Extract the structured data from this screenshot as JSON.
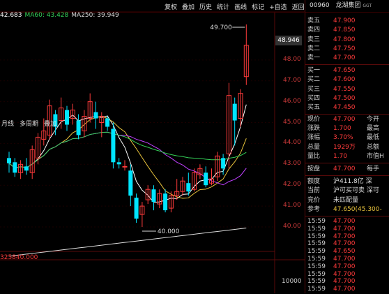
{
  "toolbar": [
    "复权",
    "叠加",
    "历史",
    "统计",
    "画线",
    "标记",
    "+自选",
    "返回"
  ],
  "ma_legend": [
    {
      "text": "42.683",
      "color": "#ffffff"
    },
    {
      "text": "MA60: 43.428",
      "color": "#34d058"
    },
    {
      "text": "MA250: 39.949",
      "color": "#dddddd"
    }
  ],
  "chart_tabs": [
    "月线",
    "多周期",
    "叠加"
  ],
  "stock": {
    "code": "00960",
    "name": "龙湖集团",
    "tag": "GGT"
  },
  "price_axis": [
    {
      "v": "48.946",
      "boxed": true
    },
    {
      "v": "48.00"
    },
    {
      "v": "47.00"
    },
    {
      "v": "46.00"
    },
    {
      "v": "45.00"
    },
    {
      "v": "44.00"
    },
    {
      "v": "43.00"
    },
    {
      "v": "42.00"
    },
    {
      "v": "41.00"
    },
    {
      "v": "40.00"
    }
  ],
  "high_label": "49.700",
  "low_label": "40.000",
  "volume_label": "325840.000",
  "volume_axis": "10000",
  "asks": [
    {
      "l": "卖五",
      "p": "47.900"
    },
    {
      "l": "卖四",
      "p": "47.850"
    },
    {
      "l": "卖三",
      "p": "47.800"
    },
    {
      "l": "卖二",
      "p": "47.750"
    },
    {
      "l": "卖一",
      "p": "47.700"
    }
  ],
  "bids": [
    {
      "l": "买一",
      "p": "47.650"
    },
    {
      "l": "买二",
      "p": "47.600"
    },
    {
      "l": "买三",
      "p": "47.550"
    },
    {
      "l": "买四",
      "p": "47.500"
    },
    {
      "l": "买五",
      "p": "47.450"
    }
  ],
  "stats": [
    {
      "l": "现价",
      "v": "47.700",
      "l2": "今开"
    },
    {
      "l": "涨跌",
      "v": "1.700",
      "l2": "最高"
    },
    {
      "l": "涨幅",
      "v": "3.70%",
      "l2": "最低"
    },
    {
      "l": "总量",
      "v": "1929万",
      "l2": "总额"
    },
    {
      "l": "量比",
      "v": "1.70",
      "l2": "市值H"
    }
  ],
  "pan": {
    "l": "按盘",
    "v": "47.700",
    "l2": "每手"
  },
  "extra": [
    {
      "l": "额度",
      "v": "沪411.8亿 深"
    },
    {
      "l": "当前",
      "v": "沪可买可卖 深可"
    },
    {
      "l": "竞价",
      "v": "未匹配量"
    },
    {
      "l": "参考",
      "v": "47.650(45.300-"
    }
  ],
  "ticks": [
    {
      "t": "15:59",
      "p": "47.700",
      "c": "red"
    },
    {
      "t": "15:59",
      "p": "47.700",
      "c": "red"
    },
    {
      "t": "15:59",
      "p": "47.700",
      "c": "red"
    },
    {
      "t": "15:59",
      "p": "47.700",
      "c": "red"
    },
    {
      "t": "15:59",
      "p": "47.650",
      "c": "red"
    },
    {
      "t": "15:59",
      "p": "47.700",
      "c": "red"
    },
    {
      "t": "15:59",
      "p": "47.700",
      "c": "red"
    },
    {
      "t": "15:59",
      "p": "47.700",
      "c": "red"
    },
    {
      "t": "15:59",
      "p": "47.700",
      "c": "red"
    },
    {
      "t": "15:59",
      "p": "47.700",
      "c": "red"
    }
  ],
  "candles": [
    [
      43.3,
      43.05,
      43.6,
      42.6
    ],
    [
      43.1,
      42.6,
      43.3,
      42.4
    ],
    [
      42.6,
      43.0,
      43.2,
      42.3
    ],
    [
      42.9,
      42.7,
      43.3,
      42.5
    ],
    [
      42.6,
      43.7,
      43.9,
      42.3
    ],
    [
      43.3,
      44.3,
      44.5,
      43.0
    ],
    [
      44.2,
      44.6,
      45.2,
      43.9
    ],
    [
      44.4,
      45.8,
      46.1,
      44.2
    ],
    [
      45.4,
      44.8,
      45.6,
      44.4
    ],
    [
      45.1,
      45.7,
      46.2,
      44.7
    ],
    [
      45.6,
      44.9,
      45.8,
      44.6
    ],
    [
      45.2,
      45.6,
      45.9,
      44.9
    ],
    [
      45.1,
      44.4,
      45.4,
      44.2
    ],
    [
      44.6,
      45.3,
      45.6,
      44.3
    ],
    [
      45.2,
      46.0,
      46.4,
      45.0
    ],
    [
      45.5,
      45.2,
      46.0,
      44.7
    ],
    [
      45.0,
      45.3,
      45.5,
      44.3
    ],
    [
      45.2,
      44.8,
      45.3,
      44.6
    ],
    [
      44.7,
      43.1,
      45.0,
      42.8
    ],
    [
      43.1,
      43.0,
      43.3,
      42.8
    ],
    [
      42.9,
      42.9,
      43.2,
      42.7
    ],
    [
      42.7,
      41.5,
      43.0,
      41.0
    ],
    [
      41.4,
      40.4,
      41.6,
      40.2
    ],
    [
      40.6,
      41.0,
      41.2,
      40.0
    ],
    [
      41.3,
      41.8,
      42.0,
      41.1
    ],
    [
      41.8,
      41.2,
      42.0,
      40.8
    ],
    [
      41.1,
      41.6,
      41.8,
      40.9
    ],
    [
      41.6,
      40.8,
      41.8,
      40.7
    ],
    [
      40.9,
      41.5,
      41.7,
      40.7
    ],
    [
      41.5,
      41.7,
      42.3,
      41.3
    ],
    [
      41.7,
      42.2,
      42.4,
      41.5
    ],
    [
      42.1,
      41.7,
      42.6,
      41.5
    ],
    [
      41.8,
      42.6,
      42.8,
      41.7
    ],
    [
      42.5,
      42.8,
      43.0,
      42.3
    ],
    [
      42.6,
      42.0,
      42.9,
      41.9
    ],
    [
      42.1,
      42.3,
      42.8,
      42.0
    ],
    [
      42.4,
      43.4,
      43.6,
      42.2
    ],
    [
      43.3,
      42.8,
      43.5,
      42.5
    ],
    [
      43.5,
      46.3,
      46.9,
      42.8
    ],
    [
      45.9,
      45.1,
      46.2,
      43.9
    ],
    [
      45.2,
      46.4,
      46.6,
      44.8
    ],
    [
      47.2,
      48.7,
      49.7,
      46.8
    ]
  ]
}
